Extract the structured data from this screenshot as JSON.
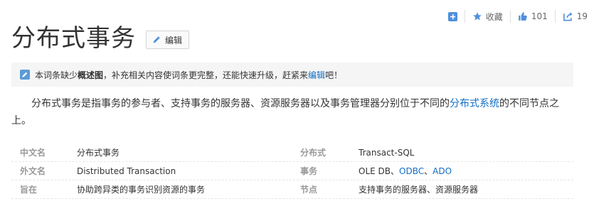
{
  "actions": {
    "add_icon": "plus-square-icon",
    "favorite_label": "收藏",
    "like_count": "101",
    "share_count": "19"
  },
  "title": "分布式事务",
  "edit_label": "编辑",
  "notice": {
    "prefix": "本词条缺少",
    "bold": "概述图",
    "middle": "，补充相关内容使词条更完整，还能快速升级，赶紧来",
    "link": "编辑",
    "suffix": "吧！"
  },
  "summary": {
    "before": "分布式事务是指事务的参与者、支持事务的服务器、资源服务器以及事务管理器分别位于不同的",
    "link": "分布式系统",
    "after": "的不同节点之上。"
  },
  "basic_info": {
    "rows": [
      {
        "name1": "中文名",
        "value1": "分布式事务",
        "name2": "分布式",
        "value2": "Transact-SQL"
      },
      {
        "name1": "外文名",
        "value1": "Distributed Transaction",
        "name2": "事务",
        "value2_prefix": "OLE DB、",
        "value2_link1": "ODBC",
        "value2_sep": "、",
        "value2_link2": "ADO"
      },
      {
        "name1": "旨在",
        "value1": "协助跨异类的事务识别资源的事务",
        "name2": "节点",
        "value2": "支持事务的服务器、资源服务器"
      }
    ]
  }
}
